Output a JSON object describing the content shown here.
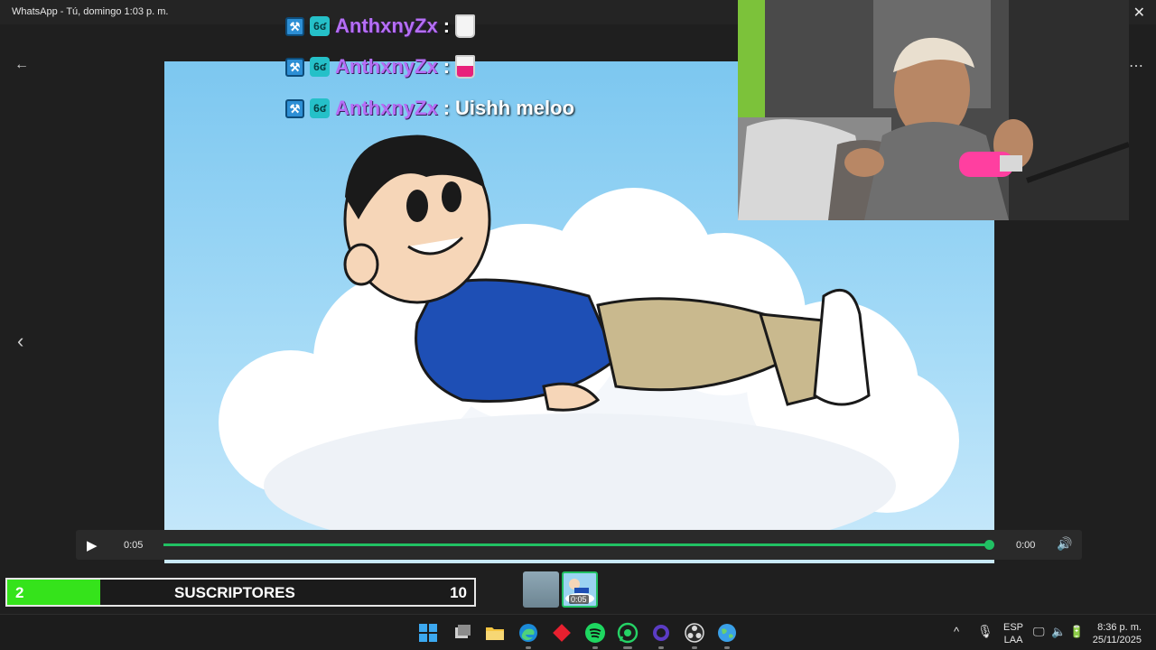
{
  "window": {
    "title": "WhatsApp - Tú, domingo 1:03 p. m.",
    "close_glyph": "✕"
  },
  "viewer": {
    "back_glyph": "←",
    "prev_glyph": "‹",
    "more_glyph": "⋯"
  },
  "chat": [
    {
      "user": "AnthxnyZx",
      "sep": ":",
      "message": "",
      "emote": "cup-white"
    },
    {
      "user": "AnthxnyZx",
      "sep": ":",
      "message": "",
      "emote": "cup-pink"
    },
    {
      "user": "AnthxnyZx",
      "sep": ":",
      "message": "Uishh meloo",
      "emote": ""
    }
  ],
  "badges": {
    "mod_glyph": "⚒",
    "sub_text": "6ʛ"
  },
  "player": {
    "play_glyph": "▶",
    "current_time": "0:05",
    "end_time": "0:00",
    "volume_glyph": "🔊",
    "progress": 1.0
  },
  "subs_bar": {
    "count": "2",
    "label": "SUSCRIPTORES",
    "goal": "10",
    "progress": 0.2
  },
  "thumbnails": [
    {
      "duration": ""
    },
    {
      "duration": "0:05"
    }
  ],
  "taskbar": {
    "apps": [
      "windows-start",
      "task-view",
      "file-explorer",
      "edge",
      "git-app",
      "spotify",
      "whatsapp",
      "cortana",
      "obs",
      "earth-app"
    ],
    "tray_arrow": "^",
    "lang_top": "ESP",
    "lang_bottom": "LAA",
    "time": "8:36 p. m.",
    "date": "25/11/2025"
  },
  "colors": {
    "accent_green": "#21c063",
    "subs_green": "#35e31b",
    "username_purple": "#b56ef5"
  }
}
